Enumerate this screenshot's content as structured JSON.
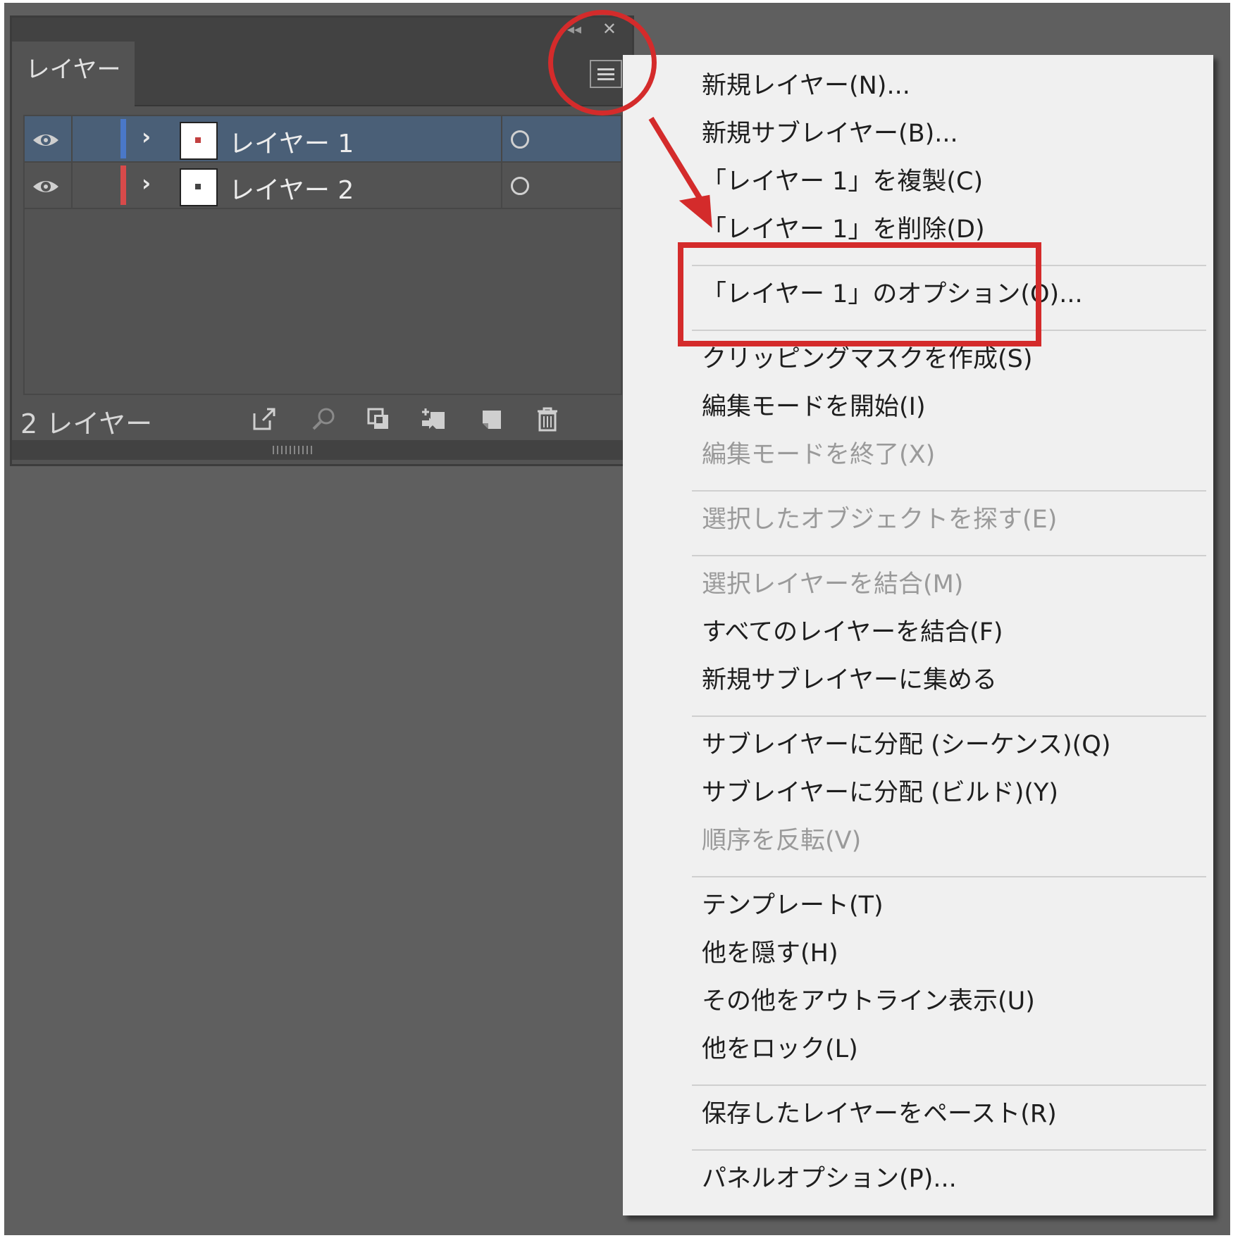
{
  "panel": {
    "tab_label": "レイヤー",
    "layers": [
      {
        "name": "レイヤー 1",
        "color": "#4a78c8",
        "selected": true
      },
      {
        "name": "レイヤー 2",
        "color": "#d84a4a",
        "selected": false
      }
    ],
    "layer_count": "2 レイヤー"
  },
  "menu": {
    "items": [
      "新規レイヤー(N)...",
      "新規サブレイヤー(B)...",
      "「レイヤー 1」を複製(C)",
      "「レイヤー 1」を削除(D)",
      "「レイヤー 1」のオプション(O)...",
      "クリッピングマスクを作成(S)",
      "編集モードを開始(I)",
      "編集モードを終了(X)",
      "選択したオブジェクトを探す(E)",
      "選択レイヤーを結合(M)",
      "すべてのレイヤーを結合(F)",
      "新規サブレイヤーに集める",
      "サブレイヤーに分配 (シーケンス)(Q)",
      "サブレイヤーに分配 (ビルド)(Y)",
      "順序を反転(V)",
      "テンプレート(T)",
      "他を隠す(H)",
      "その他をアウトライン表示(U)",
      "他をロック(L)",
      "保存したレイヤーをペースト(R)",
      "パネルオプション(P)..."
    ],
    "disabled": [
      false,
      false,
      false,
      false,
      false,
      false,
      false,
      true,
      true,
      true,
      false,
      false,
      false,
      false,
      true,
      false,
      false,
      false,
      false,
      false,
      false
    ]
  },
  "annotation_color": "#d42b2b",
  "icons": [
    "eye-icon",
    "chevron-right-icon",
    "target-circle-icon",
    "export-icon",
    "search-icon",
    "clipping-mask-icon",
    "new-sublayer-icon",
    "new-layer-icon",
    "trash-icon",
    "panel-menu-icon",
    "close-icon",
    "collapse-icon"
  ]
}
